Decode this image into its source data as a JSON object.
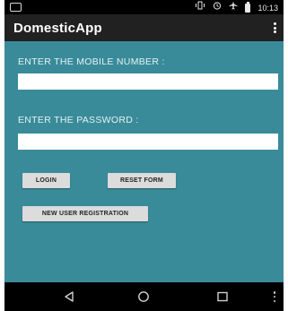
{
  "status_bar": {
    "time": "10:13",
    "icons": [
      "vibrate-icon",
      "alarm-icon",
      "airplane-mode-icon",
      "battery-icon"
    ]
  },
  "app_bar": {
    "title": "DomesticApp",
    "overflow_icon": "more-vertical-icon"
  },
  "form": {
    "mobile_label": "ENTER THE MOBILE NUMBER :",
    "mobile_value": "",
    "password_label": "ENTER THE PASSWORD :",
    "password_value": ""
  },
  "buttons": {
    "login": "LOGIN",
    "reset": "RESET FORM",
    "register": "NEW USER REGISTRATION"
  },
  "nav_bar": {
    "icons": [
      "back-icon",
      "home-icon",
      "recents-icon",
      "more-vertical-icon"
    ]
  },
  "colors": {
    "app_bar": "#212121",
    "background": "#3a8b99",
    "button": "#dcdcdc"
  }
}
